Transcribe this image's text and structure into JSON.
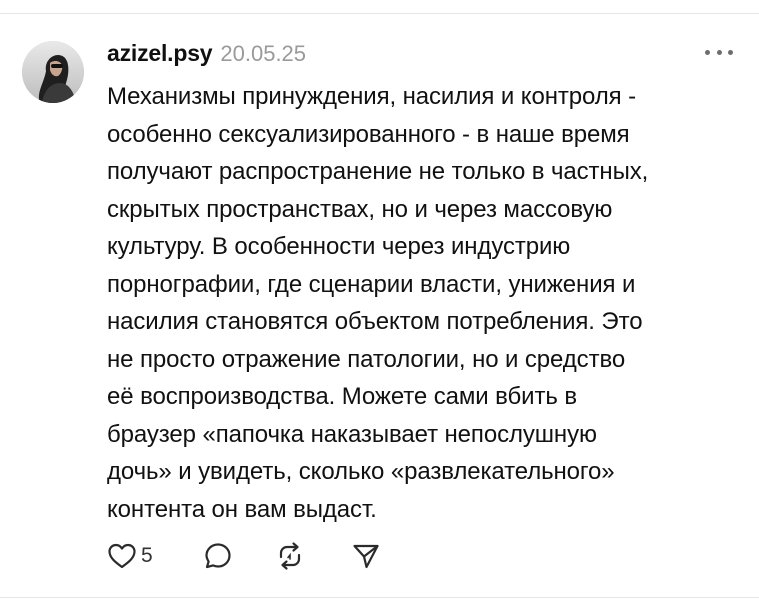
{
  "post": {
    "username": "azizel.psy",
    "timestamp": "20.05.25",
    "body_lines": [
      "Механизмы принуждения, насилия и контроля -",
      "особенно сексуализированного - в наше время",
      "получают распространение не только в частных,",
      "скрытых пространствах, но и через массовую",
      "культуру. В особенности через индустрию",
      "порнографии, где сценарии власти, унижения и",
      "насилия становятся объектом потребления. Это",
      "не просто отражение патологии, но и средство",
      "её воспроизводства. Можете сами вбить в",
      "браузер «папочка наказывает непослушную",
      "дочь» и увидеть, сколько «развлекательного»",
      "контента он вам выдаст."
    ],
    "like_count": "5"
  },
  "icons": {
    "more": "more-horizontal-icon",
    "like": "heart-icon",
    "comment": "comment-icon",
    "repost": "repost-icon",
    "share": "send-icon"
  },
  "colors": {
    "text": "#101010",
    "muted": "#9a9a9a",
    "icon": "#2b2b2b"
  }
}
